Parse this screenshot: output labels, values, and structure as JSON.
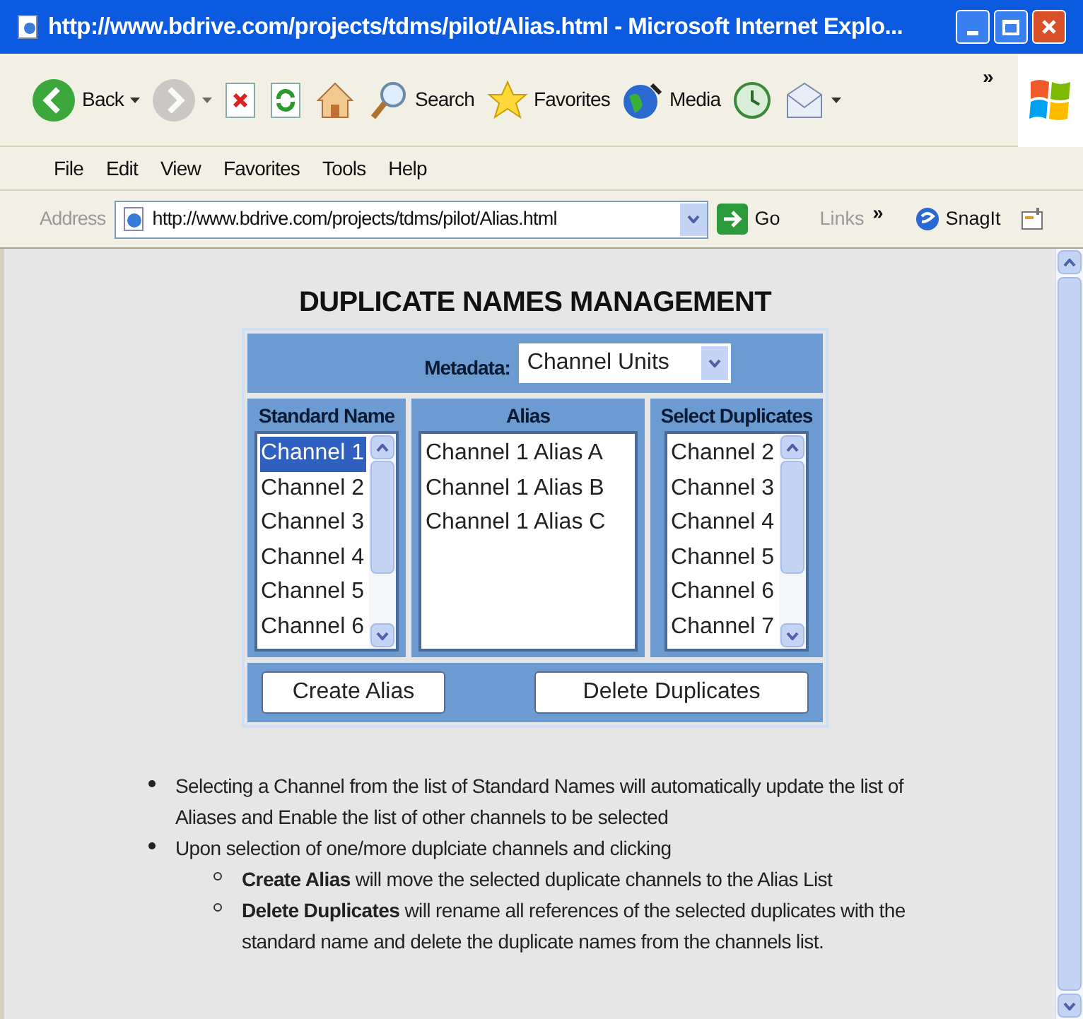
{
  "window": {
    "title": "http://www.bdrive.com/projects/tdms/pilot/Alias.html - Microsoft Internet Explo..."
  },
  "toolbar": {
    "buttons": [
      {
        "kind": "back",
        "label": "Back",
        "dropdown": true,
        "disabled": false
      },
      {
        "kind": "forward",
        "dropdown": true,
        "disabled": true
      },
      {
        "kind": "stop",
        "dropdown": false,
        "disabled": false
      },
      {
        "kind": "refresh",
        "dropdown": false,
        "disabled": false
      },
      {
        "kind": "home",
        "dropdown": false,
        "disabled": false
      },
      {
        "kind": "search",
        "label": "Search",
        "dropdown": false,
        "disabled": false
      },
      {
        "kind": "favorites",
        "label": "Favorites",
        "dropdown": false,
        "disabled": false
      },
      {
        "kind": "media",
        "label": "Media",
        "dropdown": false,
        "disabled": false
      },
      {
        "kind": "history",
        "dropdown": false,
        "disabled": false
      },
      {
        "kind": "mail",
        "dropdown": true,
        "disabled": false
      }
    ],
    "overflow": "»"
  },
  "menu": [
    "File",
    "Edit",
    "View",
    "Favorites",
    "Tools",
    "Help"
  ],
  "address_bar": {
    "label": "Address",
    "value": "http://www.bdrive.com/projects/tdms/pilot/Alias.html",
    "go": "Go",
    "links": "Links",
    "links_overflow": "»",
    "snagit": "SnagIt"
  },
  "page": {
    "heading": "DUPLICATE NAMES MANAGEMENT",
    "metadata": {
      "label": "Metadata:",
      "value": "Channel Units"
    },
    "columns": [
      {
        "kind": "scroll",
        "heading": "Standard Name",
        "items": [
          {
            "label": "Channel 1",
            "selected": true
          },
          {
            "label": "Channel 2",
            "selected": false
          },
          {
            "label": "Channel 3",
            "selected": false
          },
          {
            "label": "Channel 4",
            "selected": false
          },
          {
            "label": "Channel 5",
            "selected": false
          },
          {
            "label": "Channel 6",
            "selected": false
          }
        ]
      },
      {
        "kind": "plain",
        "heading": "Alias",
        "items": [
          {
            "label": "Channel 1 Alias A",
            "selected": false
          },
          {
            "label": "Channel 1 Alias B",
            "selected": false
          },
          {
            "label": "Channel 1 Alias C",
            "selected": false
          }
        ]
      },
      {
        "kind": "scroll",
        "heading": "Select Duplicates",
        "items": [
          {
            "label": "Channel 2",
            "selected": false
          },
          {
            "label": "Channel 3",
            "selected": false
          },
          {
            "label": "Channel 4",
            "selected": false
          },
          {
            "label": "Channel 5",
            "selected": false
          },
          {
            "label": "Channel 6",
            "selected": false
          },
          {
            "label": "Channel 7",
            "selected": false
          }
        ]
      }
    ],
    "buttons": [
      "Create Alias",
      "Delete Duplicates"
    ],
    "notes": [
      {
        "text": "Selecting a Channel from the list of Standard Names will automatically update the list of Aliases and Enable the list of other channels to be selected"
      },
      {
        "text": "Upon selection of one/more duplciate channels and clicking",
        "children": [
          {
            "text": "**Create Alias** will move the selected duplicate channels to the Alias List"
          },
          {
            "text": "**Delete Duplicates** will rename all references of the selected duplicates with the standard name and delete the duplicate names from the channels list."
          }
        ]
      }
    ]
  }
}
